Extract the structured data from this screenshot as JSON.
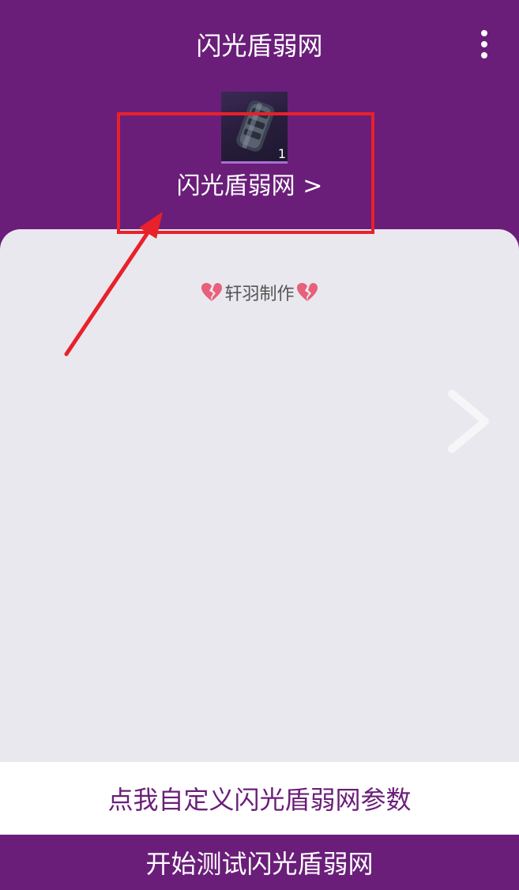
{
  "header": {
    "title": "闪光盾弱网",
    "menu_icon": "more-vertical-icon"
  },
  "item": {
    "name": "闪光盾弱网 >",
    "count": "1",
    "thumbnail_icon": "shield-item-icon"
  },
  "panel": {
    "credit_text": "轩羽制作",
    "credit_icon": "broken-heart-icon",
    "next_icon": "chevron-right-icon"
  },
  "buttons": {
    "customize_label": "点我自定义闪光盾弱网参数",
    "start_label": "开始测试闪光盾弱网"
  },
  "colors": {
    "primary": "#6a1e79",
    "panel_bg": "#e9e8ee",
    "annotation": "#e8212a"
  }
}
